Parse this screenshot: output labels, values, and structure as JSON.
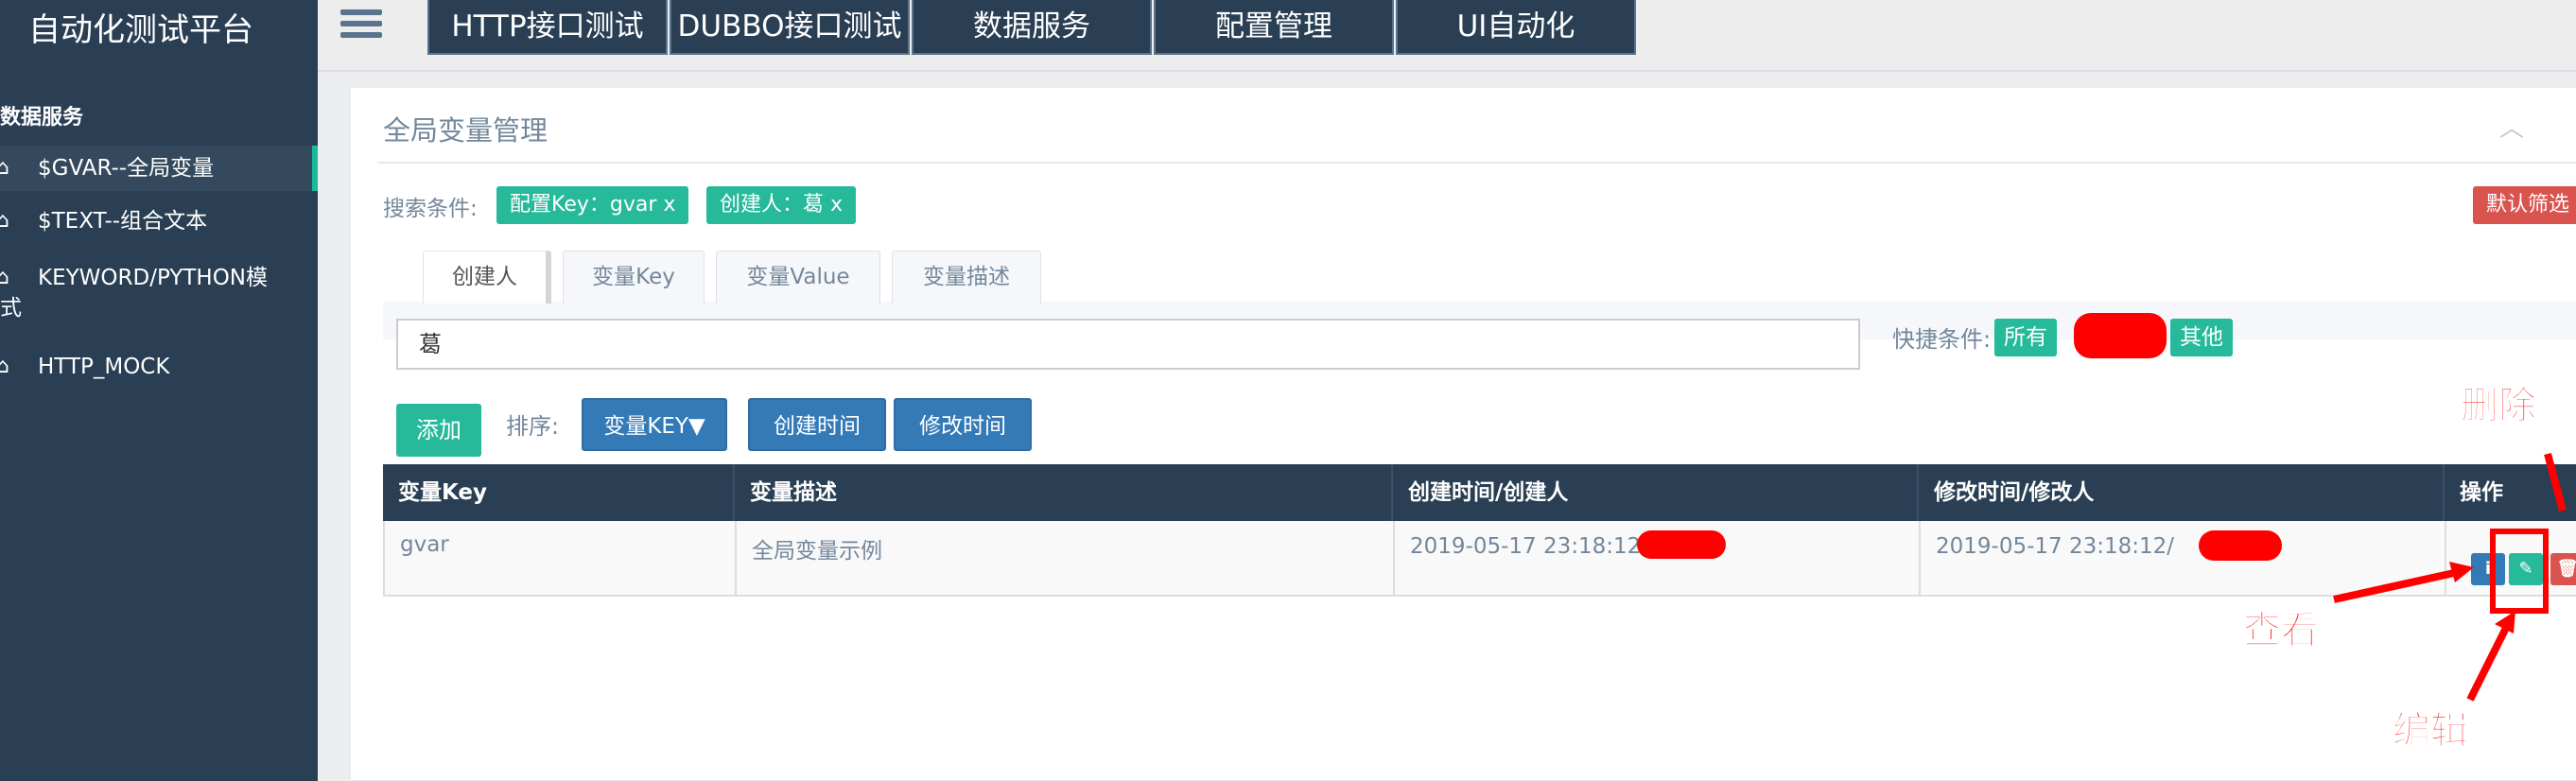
{
  "app": {
    "title": "自动化测试平台"
  },
  "topnav": [
    {
      "label": "HTTP接口测试"
    },
    {
      "label": "DUBBO接口测试"
    },
    {
      "label": "数据服务"
    },
    {
      "label": "配置管理"
    },
    {
      "label": "UI自动化"
    }
  ],
  "sidebar": {
    "section": "数据服务",
    "items": [
      {
        "label": "$GVAR--全局变量",
        "icon": "home-icon",
        "active": true
      },
      {
        "label": "$TEXT--组合文本",
        "icon": "home-icon",
        "active": false
      },
      {
        "label": "KEYWORD/PYTHON模",
        "label_tail": "式",
        "icon": "home-icon",
        "active": false
      },
      {
        "label": "HTTP_MOCK",
        "icon": "home-icon",
        "active": false
      }
    ]
  },
  "panel": {
    "title": "全局变量管理",
    "collapse_icon": "chevron-up-icon",
    "search_label": "搜索条件:",
    "chips": [
      {
        "label": "配置Key：gvar  x"
      },
      {
        "label": "创建人：葛  x"
      }
    ],
    "default_filter": "默认筛选"
  },
  "tabs": [
    {
      "label": "创建人",
      "active": true
    },
    {
      "label": "变量Key",
      "active": false
    },
    {
      "label": "变量Value",
      "active": false
    },
    {
      "label": "变量描述",
      "active": false
    }
  ],
  "filter": {
    "value": "葛",
    "quick_label": "快捷条件:",
    "quick_all": "所有",
    "quick_other": "其他"
  },
  "actions": {
    "add": "添加",
    "sort_label": "排序:",
    "sort_buttons": [
      {
        "label": "变量KEY▼"
      },
      {
        "label": "创建时间"
      },
      {
        "label": "修改时间"
      }
    ]
  },
  "table": {
    "columns": [
      "变量Key",
      "变量描述",
      "创建时间/创建人",
      "修改时间/修改人",
      "操作"
    ],
    "rows": [
      {
        "key": "gvar",
        "desc": "全局变量示例",
        "created": "2019-05-17 23:18:12/",
        "modified": "2019-05-17 23:18:12/"
      }
    ],
    "row_actions": [
      {
        "name": "view",
        "icon": "info-icon",
        "color": "#337ab7"
      },
      {
        "name": "edit",
        "icon": "edit-icon",
        "color": "#26b99a"
      },
      {
        "name": "delete",
        "icon": "trash-icon",
        "color": "#d9534f"
      }
    ]
  },
  "annotations": {
    "delete": "删除",
    "view": "查看",
    "edit": "编辑",
    "color": "#ff0000"
  }
}
